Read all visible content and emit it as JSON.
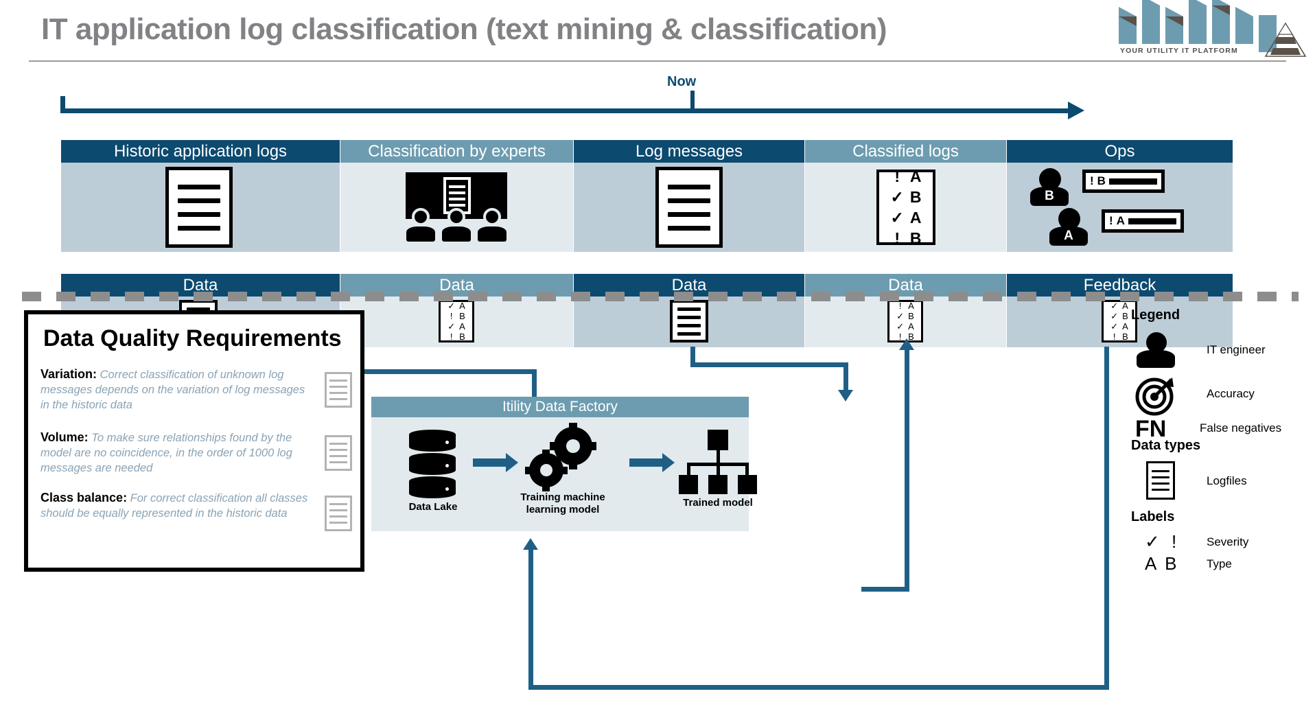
{
  "header": {
    "title": "IT application log classification (text mining & classification)",
    "logo": {
      "wordmark": "itility",
      "tagline": "YOUR UTILITY IT PLATFORM",
      "icon": "pyramid-icon"
    }
  },
  "timeline": {
    "now_label": "Now"
  },
  "pipeline_row1": [
    {
      "title": "Historic application logs",
      "icon": "logfile-icon",
      "tone": "dark"
    },
    {
      "title": "Classification by experts",
      "icon": "experts-classroom-icon",
      "tone": "light"
    },
    {
      "title": "Log messages",
      "icon": "logfile-icon",
      "tone": "dark"
    },
    {
      "title": "Classified logs",
      "icon": "classified-log-icon",
      "tone": "light",
      "rows": [
        {
          "severity": "!",
          "type": "A"
        },
        {
          "severity": "✓",
          "type": "B"
        },
        {
          "severity": "✓",
          "type": "A"
        },
        {
          "severity": "!",
          "type": "B"
        }
      ]
    },
    {
      "title": "Ops",
      "icon": "it-engineer-icon",
      "tone": "dark",
      "engineers": [
        {
          "label": "B",
          "message_severity": "!",
          "message_type": "B"
        },
        {
          "label": "A",
          "message_severity": "!",
          "message_type": "A"
        }
      ]
    }
  ],
  "pipeline_row2": [
    {
      "title": "Data",
      "icon": "logfile-icon",
      "tone": "dark"
    },
    {
      "title": "Data",
      "icon": "classified-log-icon",
      "tone": "light",
      "rows": [
        {
          "severity": "✓",
          "type": "A"
        },
        {
          "severity": "!",
          "type": "B"
        },
        {
          "severity": "✓",
          "type": "A"
        },
        {
          "severity": "!",
          "type": "B"
        }
      ]
    },
    {
      "title": "Data",
      "icon": "logfile-icon",
      "tone": "dark"
    },
    {
      "title": "Data",
      "icon": "classified-log-icon",
      "tone": "light",
      "rows": [
        {
          "severity": "!",
          "type": "A"
        },
        {
          "severity": "✓",
          "type": "B"
        },
        {
          "severity": "✓",
          "type": "A"
        },
        {
          "severity": "!",
          "type": "B"
        }
      ]
    },
    {
      "title": "Feedback",
      "icon": "classified-log-icon",
      "tone": "dark",
      "rows": [
        {
          "severity": "✓",
          "type": "A"
        },
        {
          "severity": "✓",
          "type": "B"
        },
        {
          "severity": "✓",
          "type": "A"
        },
        {
          "severity": "!",
          "type": "B"
        }
      ]
    }
  ],
  "data_quality": {
    "title": "Data Quality Requirements",
    "items": [
      {
        "key": "Variation:",
        "text": "Correct classification of unknown log messages depends on the variation of log messages in the historic data",
        "icon": "logfile-outline-icon"
      },
      {
        "key": "Volume:",
        "text": "To make sure relationships found by the model are no coincidence, in the order of 1000 log messages are needed",
        "icon": "logfile-outline-icon"
      },
      {
        "key": "Class balance:",
        "text": "For correct classification all classes should be equally represented in the historic data",
        "icon": "logfile-outline-icon"
      }
    ]
  },
  "factory": {
    "title": "Itility Data Factory",
    "nodes": [
      {
        "label": "Data Lake",
        "icon": "database-icon"
      },
      {
        "label": "Training machine learning model",
        "icon": "gears-icon"
      },
      {
        "label": "Trained model",
        "icon": "model-tree-icon"
      }
    ]
  },
  "legend": {
    "title": "Legend",
    "items": [
      {
        "icon": "it-engineer-icon",
        "label": "IT engineer"
      },
      {
        "icon": "target-accuracy-icon",
        "label": "Accuracy"
      },
      {
        "icon": "fn-text-icon",
        "glyph": "FN",
        "label": "False negatives"
      }
    ],
    "data_types_title": "Data types",
    "data_types": [
      {
        "icon": "logfile-icon",
        "label": "Logfiles"
      }
    ],
    "labels_title": "Labels",
    "labels": [
      {
        "glyph": "✓ !",
        "label": "Severity",
        "icon": "severity-icon"
      },
      {
        "glyph": "A B",
        "label": "Type",
        "icon": "type-icon"
      }
    ]
  },
  "colors": {
    "navy": "#0d4a70",
    "steel": "#6d9cb0",
    "body_dark": "#bdcdd8",
    "body_light": "#e2eaee",
    "connector": "#1f5f86",
    "title_gray": "#808285",
    "italic_blue": "#8aa3b5"
  }
}
